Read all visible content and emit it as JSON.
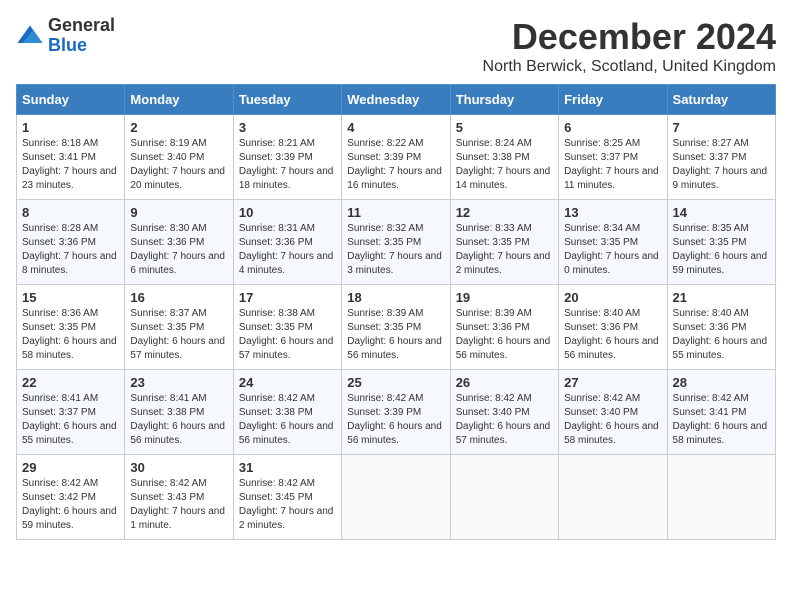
{
  "logo": {
    "general": "General",
    "blue": "Blue"
  },
  "title": "December 2024",
  "location": "North Berwick, Scotland, United Kingdom",
  "days_of_week": [
    "Sunday",
    "Monday",
    "Tuesday",
    "Wednesday",
    "Thursday",
    "Friday",
    "Saturday"
  ],
  "weeks": [
    [
      {
        "day": "1",
        "sunrise": "8:18 AM",
        "sunset": "3:41 PM",
        "daylight": "7 hours and 23 minutes."
      },
      {
        "day": "2",
        "sunrise": "8:19 AM",
        "sunset": "3:40 PM",
        "daylight": "7 hours and 20 minutes."
      },
      {
        "day": "3",
        "sunrise": "8:21 AM",
        "sunset": "3:39 PM",
        "daylight": "7 hours and 18 minutes."
      },
      {
        "day": "4",
        "sunrise": "8:22 AM",
        "sunset": "3:39 PM",
        "daylight": "7 hours and 16 minutes."
      },
      {
        "day": "5",
        "sunrise": "8:24 AM",
        "sunset": "3:38 PM",
        "daylight": "7 hours and 14 minutes."
      },
      {
        "day": "6",
        "sunrise": "8:25 AM",
        "sunset": "3:37 PM",
        "daylight": "7 hours and 11 minutes."
      },
      {
        "day": "7",
        "sunrise": "8:27 AM",
        "sunset": "3:37 PM",
        "daylight": "7 hours and 9 minutes."
      }
    ],
    [
      {
        "day": "8",
        "sunrise": "8:28 AM",
        "sunset": "3:36 PM",
        "daylight": "7 hours and 8 minutes."
      },
      {
        "day": "9",
        "sunrise": "8:30 AM",
        "sunset": "3:36 PM",
        "daylight": "7 hours and 6 minutes."
      },
      {
        "day": "10",
        "sunrise": "8:31 AM",
        "sunset": "3:36 PM",
        "daylight": "7 hours and 4 minutes."
      },
      {
        "day": "11",
        "sunrise": "8:32 AM",
        "sunset": "3:35 PM",
        "daylight": "7 hours and 3 minutes."
      },
      {
        "day": "12",
        "sunrise": "8:33 AM",
        "sunset": "3:35 PM",
        "daylight": "7 hours and 2 minutes."
      },
      {
        "day": "13",
        "sunrise": "8:34 AM",
        "sunset": "3:35 PM",
        "daylight": "7 hours and 0 minutes."
      },
      {
        "day": "14",
        "sunrise": "8:35 AM",
        "sunset": "3:35 PM",
        "daylight": "6 hours and 59 minutes."
      }
    ],
    [
      {
        "day": "15",
        "sunrise": "8:36 AM",
        "sunset": "3:35 PM",
        "daylight": "6 hours and 58 minutes."
      },
      {
        "day": "16",
        "sunrise": "8:37 AM",
        "sunset": "3:35 PM",
        "daylight": "6 hours and 57 minutes."
      },
      {
        "day": "17",
        "sunrise": "8:38 AM",
        "sunset": "3:35 PM",
        "daylight": "6 hours and 57 minutes."
      },
      {
        "day": "18",
        "sunrise": "8:39 AM",
        "sunset": "3:35 PM",
        "daylight": "6 hours and 56 minutes."
      },
      {
        "day": "19",
        "sunrise": "8:39 AM",
        "sunset": "3:36 PM",
        "daylight": "6 hours and 56 minutes."
      },
      {
        "day": "20",
        "sunrise": "8:40 AM",
        "sunset": "3:36 PM",
        "daylight": "6 hours and 56 minutes."
      },
      {
        "day": "21",
        "sunrise": "8:40 AM",
        "sunset": "3:36 PM",
        "daylight": "6 hours and 55 minutes."
      }
    ],
    [
      {
        "day": "22",
        "sunrise": "8:41 AM",
        "sunset": "3:37 PM",
        "daylight": "6 hours and 55 minutes."
      },
      {
        "day": "23",
        "sunrise": "8:41 AM",
        "sunset": "3:38 PM",
        "daylight": "6 hours and 56 minutes."
      },
      {
        "day": "24",
        "sunrise": "8:42 AM",
        "sunset": "3:38 PM",
        "daylight": "6 hours and 56 minutes."
      },
      {
        "day": "25",
        "sunrise": "8:42 AM",
        "sunset": "3:39 PM",
        "daylight": "6 hours and 56 minutes."
      },
      {
        "day": "26",
        "sunrise": "8:42 AM",
        "sunset": "3:40 PM",
        "daylight": "6 hours and 57 minutes."
      },
      {
        "day": "27",
        "sunrise": "8:42 AM",
        "sunset": "3:40 PM",
        "daylight": "6 hours and 58 minutes."
      },
      {
        "day": "28",
        "sunrise": "8:42 AM",
        "sunset": "3:41 PM",
        "daylight": "6 hours and 58 minutes."
      }
    ],
    [
      {
        "day": "29",
        "sunrise": "8:42 AM",
        "sunset": "3:42 PM",
        "daylight": "6 hours and 59 minutes."
      },
      {
        "day": "30",
        "sunrise": "8:42 AM",
        "sunset": "3:43 PM",
        "daylight": "7 hours and 1 minute."
      },
      {
        "day": "31",
        "sunrise": "8:42 AM",
        "sunset": "3:45 PM",
        "daylight": "7 hours and 2 minutes."
      },
      null,
      null,
      null,
      null
    ]
  ],
  "labels": {
    "sunrise": "Sunrise:",
    "sunset": "Sunset:",
    "daylight": "Daylight:"
  }
}
